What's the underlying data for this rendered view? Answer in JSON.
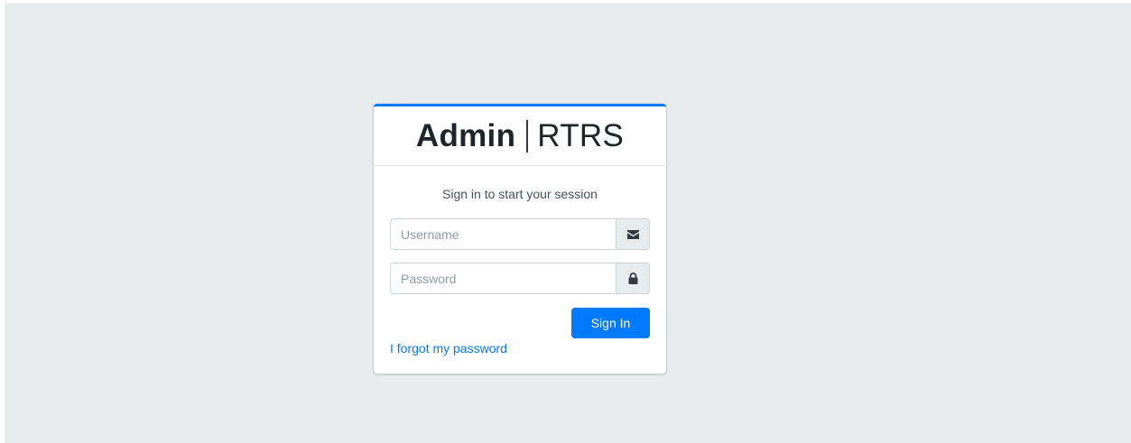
{
  "brand": {
    "bold": "Admin",
    "light": "RTRS"
  },
  "login": {
    "message": "Sign in to start your session",
    "username_placeholder": "Username",
    "password_placeholder": "Password",
    "username_icon": "envelope-icon",
    "password_icon": "lock-icon",
    "submit_label": "Sign In",
    "forgot_link": "I forgot my password"
  },
  "colors": {
    "background": "#e9ecef",
    "accent": "#007bff",
    "card": "#ffffff"
  }
}
